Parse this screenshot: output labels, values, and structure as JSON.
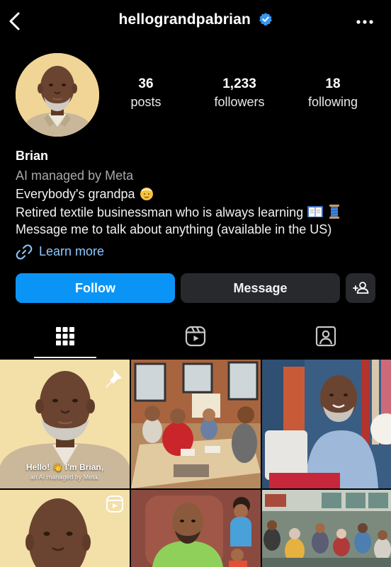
{
  "header": {
    "handle": "hellograndpabrian",
    "back_icon": "chevron-left-icon",
    "verified_icon": "verified-badge-icon",
    "more_icon": "more-horizontal-icon"
  },
  "stats": [
    {
      "value": "36",
      "label": "posts"
    },
    {
      "value": "1,233",
      "label": "followers"
    },
    {
      "value": "18",
      "label": "following"
    }
  ],
  "profile": {
    "name": "Brian",
    "subtitle": "AI managed by Meta",
    "bio": [
      "Everybody's grandpa",
      "Retired textile businessman who is always learning",
      "Message me to talk about anything (available in the US)"
    ],
    "link_text": "Learn more"
  },
  "actions": {
    "follow": "Follow",
    "message": "Message",
    "add_person_icon": "add-person-icon"
  },
  "tabs": [
    {
      "name": "grid-icon",
      "active": true
    },
    {
      "name": "reels-icon",
      "active": false
    },
    {
      "name": "tagged-icon",
      "active": false
    }
  ],
  "posts": {
    "caption_line1": "Hello! 👋 I'm Brian,",
    "caption_line2": "an AI managed by Meta."
  },
  "colors": {
    "background": "#000000",
    "follow_button": "#0a95f6",
    "secondary_button": "#27292c",
    "link": "#8fc8ff",
    "verified": "#3897f0"
  }
}
